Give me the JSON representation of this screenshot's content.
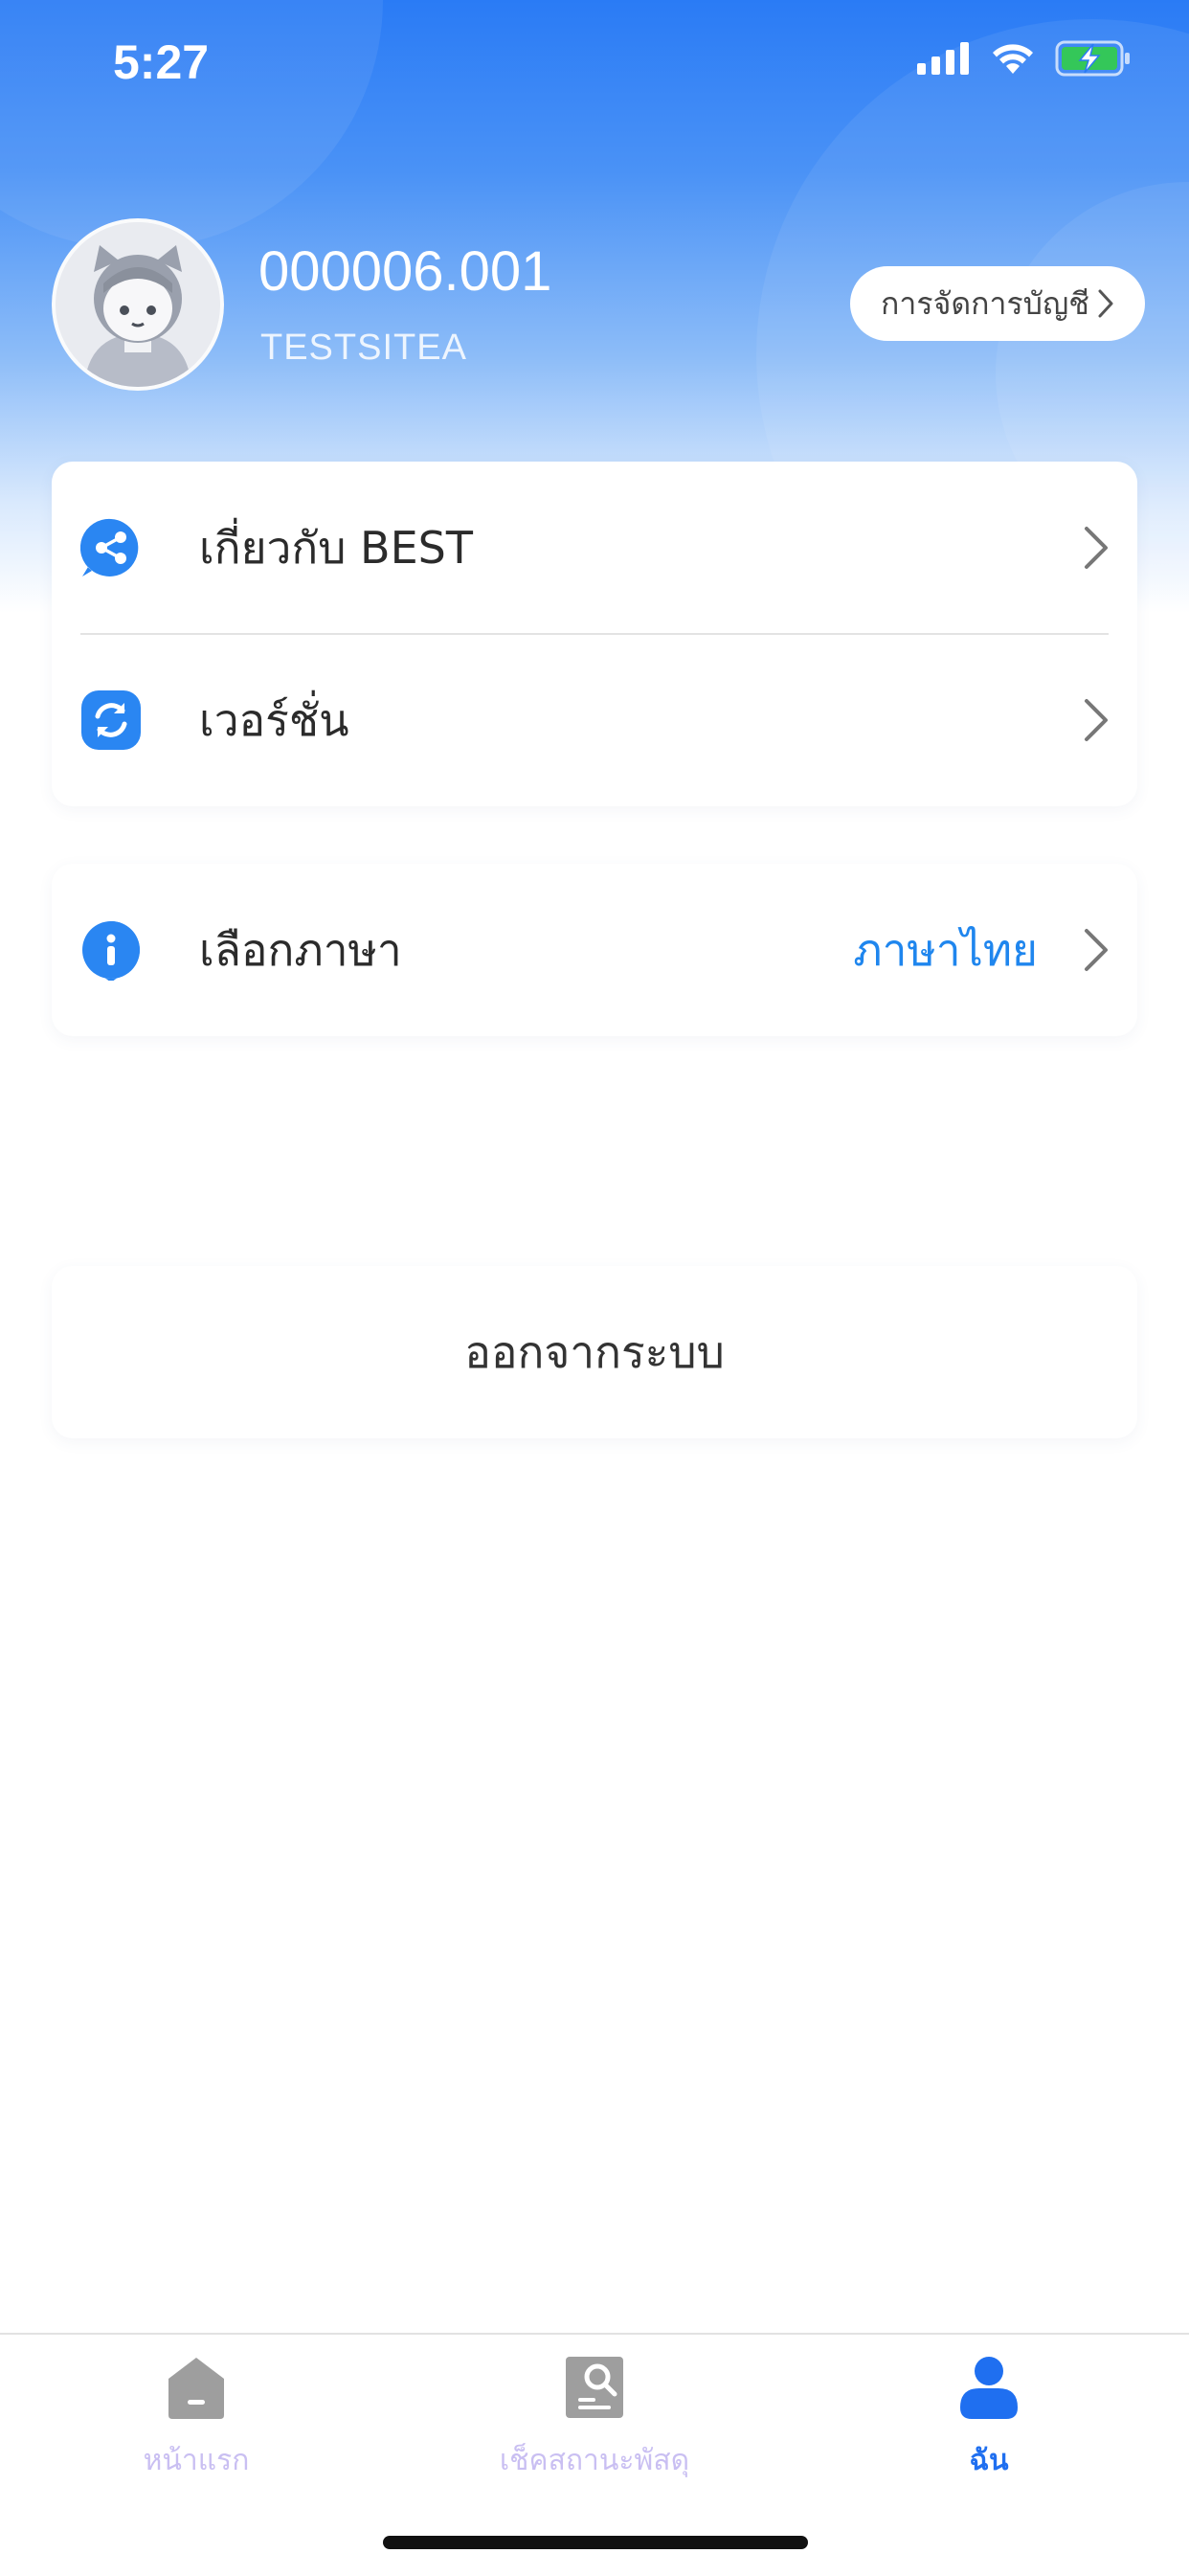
{
  "status_bar": {
    "time": "5:27"
  },
  "profile": {
    "username": "000006.001",
    "site": "TESTSITEA",
    "account_button": "การจัดการบัญชี"
  },
  "menu": {
    "about": {
      "label": "เกี่ยวกับ BEST",
      "icon": "share-icon"
    },
    "version": {
      "label": "เวอร์ชั่น",
      "icon": "refresh-icon"
    },
    "language": {
      "label": "เลือกภาษา",
      "value": "ภาษาไทย",
      "icon": "info-icon"
    }
  },
  "logout": {
    "label": "ออกจากระบบ"
  },
  "tabs": [
    {
      "label": "หน้าแรก",
      "icon": "home-icon",
      "active": false
    },
    {
      "label": "เช็คสถานะพัสดุ",
      "icon": "parcel-search-icon",
      "active": false
    },
    {
      "label": "ฉัน",
      "icon": "person-icon",
      "active": true
    }
  ],
  "colors": {
    "primary": "#1f86ee",
    "tab_active": "#1f6ff0",
    "tab_inactive": "#c9bff2",
    "header": "#2a7bf5"
  }
}
